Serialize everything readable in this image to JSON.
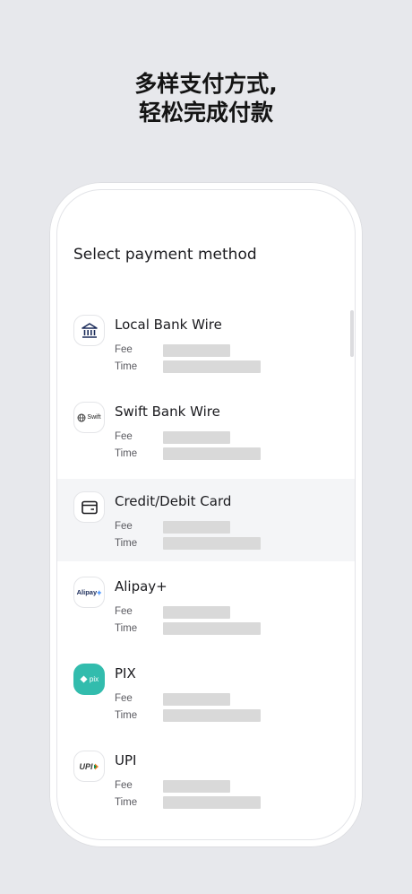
{
  "headline": {
    "line1": "多样支付方式,",
    "line2": "轻松完成付款"
  },
  "screen": {
    "title": "Select payment method"
  },
  "methods": [
    {
      "label": "Local Bank Wire",
      "icon": "bank-icon",
      "fee_label": "Fee",
      "time_label": "Time"
    },
    {
      "label": "Swift Bank Wire",
      "icon": "swift-globe-icon",
      "icon_text": "Swift",
      "fee_label": "Fee",
      "time_label": "Time"
    },
    {
      "label": "Credit/Debit Card",
      "icon": "card-icon",
      "fee_label": "Fee",
      "time_label": "Time",
      "selected": true
    },
    {
      "label": "Alipay+",
      "icon": "alipay-plus-logo",
      "icon_text": "Alipay",
      "fee_label": "Fee",
      "time_label": "Time"
    },
    {
      "label": "PIX",
      "icon": "pix-logo",
      "icon_text": "pix",
      "fee_label": "Fee",
      "time_label": "Time"
    },
    {
      "label": "UPI",
      "icon": "upi-logo",
      "icon_text": "UPI",
      "fee_label": "Fee",
      "time_label": "Time"
    }
  ],
  "colors": {
    "background": "#e7e8ec",
    "selected_row": "#f4f5f7",
    "placeholder": "#d9d9d9",
    "pix": "#32bcad"
  }
}
